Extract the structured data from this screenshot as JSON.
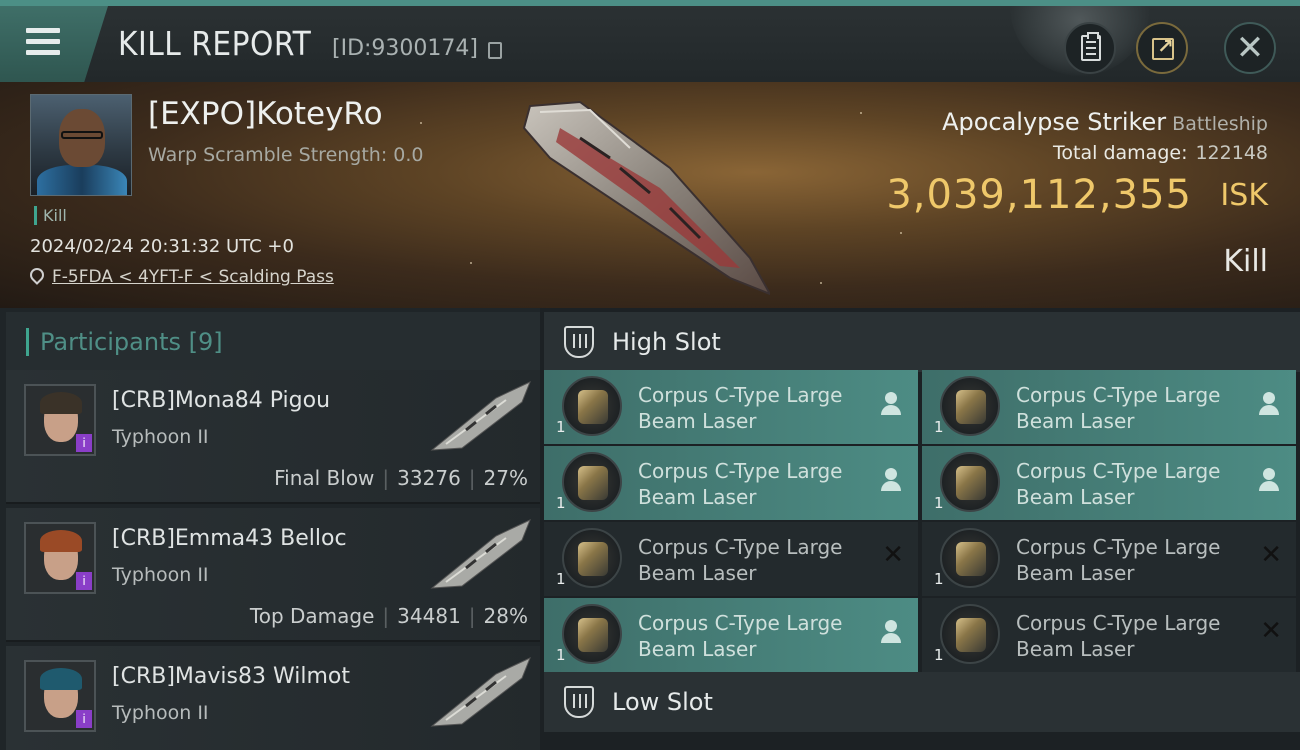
{
  "header": {
    "title": "KILL REPORT",
    "report_id": "[ID:9300174]"
  },
  "victim": {
    "name": "[EXPO]KoteyRo",
    "warp_scramble": "Warp Scramble Strength: 0.0",
    "tag": "Kill",
    "time": "2024/02/24 20:31:32 UTC +0",
    "location": "F-5FDA < 4YFT-F < Scalding Pass",
    "ship_name": "Apocalypse Striker",
    "ship_class": "Battleship",
    "total_damage_label": "Total damage:",
    "total_damage_value": "122148",
    "isk_value": "3,039,112,355",
    "isk_unit": "ISK",
    "result": "Kill"
  },
  "participants": {
    "label": "Participants",
    "count": "[9]",
    "items": [
      {
        "name": "[CRB]Mona84 Pigou",
        "ship": "Typhoon II",
        "role": "Final Blow",
        "damage": "33276",
        "percent": "27%"
      },
      {
        "name": "[CRB]Emma43 Belloc",
        "ship": "Typhoon II",
        "role": "Top Damage",
        "damage": "34481",
        "percent": "28%"
      },
      {
        "name": "[CRB]Mavis83 Wilmot",
        "ship": "Typhoon II",
        "role": "",
        "damage": "",
        "percent": ""
      }
    ]
  },
  "fitting": {
    "high_slot_label": "High Slot",
    "low_slot_label": "Low Slot",
    "high_slots": [
      {
        "qty": "1",
        "name_line1": "Corpus C-Type Large",
        "name_line2": "Beam Laser",
        "status": "person-icon",
        "active": true
      },
      {
        "qty": "1",
        "name_line1": "Corpus C-Type Large",
        "name_line2": "Beam Laser",
        "status": "person-icon",
        "active": true
      },
      {
        "qty": "1",
        "name_line1": "Corpus C-Type Large",
        "name_line2": "Beam Laser",
        "status": "person-icon",
        "active": true
      },
      {
        "qty": "1",
        "name_line1": "Corpus C-Type Large",
        "name_line2": "Beam Laser",
        "status": "person-icon",
        "active": true
      },
      {
        "qty": "1",
        "name_line1": "Corpus C-Type Large",
        "name_line2": "Beam Laser",
        "status": "destroyed-x-icon",
        "active": false
      },
      {
        "qty": "1",
        "name_line1": "Corpus C-Type Large",
        "name_line2": "Beam Laser",
        "status": "destroyed-x-icon",
        "active": false
      },
      {
        "qty": "1",
        "name_line1": "Corpus C-Type Large",
        "name_line2": "Beam Laser",
        "status": "person-icon",
        "active": true
      },
      {
        "qty": "1",
        "name_line1": "Corpus C-Type Large",
        "name_line2": "Beam Laser",
        "status": "destroyed-x-icon",
        "active": false
      }
    ]
  },
  "colors": {
    "accent": "#4d8c84",
    "isk_gold": "#efc86a",
    "active_module": "#4d8c84",
    "inactive_module": "#232a2d"
  }
}
